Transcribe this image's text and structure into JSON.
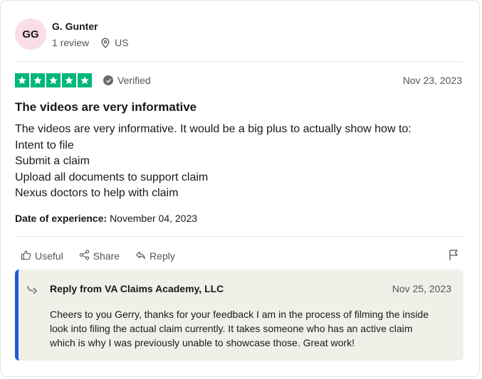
{
  "reviewer": {
    "initials": "GG",
    "name": "G. Gunter",
    "review_count": "1 review",
    "country": "US"
  },
  "review": {
    "rating": 5,
    "verified_label": "Verified",
    "date": "Nov 23, 2023",
    "title": "The videos are very informative",
    "body_lines": [
      "The videos are very informative. It would be a big plus to actually show how to:",
      "Intent to file",
      "Submit a claim",
      "Upload all documents to support claim",
      "Nexus doctors to help with claim"
    ],
    "experience_label": "Date of experience:",
    "experience_date": "November 04, 2023"
  },
  "actions": {
    "useful": "Useful",
    "share": "Share",
    "reply": "Reply"
  },
  "company_reply": {
    "title": "Reply from VA Claims Academy, LLC",
    "date": "Nov 25, 2023",
    "text_lines": [
      "Cheers to you Gerry, thanks for your feedback I am in the process of filming the inside",
      "look into filing the actual claim currently. It takes someone who has an active claim",
      "which is why I was previously unable to showcase those. Great work!"
    ]
  },
  "colors": {
    "star_green": "#00b67a",
    "reply_accent": "#1c5cd8",
    "avatar_bg": "#fbdde5"
  },
  "icons": [
    "location-pin-icon",
    "star-icon",
    "check-icon",
    "thumbs-up-icon",
    "share-icon",
    "reply-icon",
    "flag-icon",
    "reply-arrow-icon"
  ]
}
